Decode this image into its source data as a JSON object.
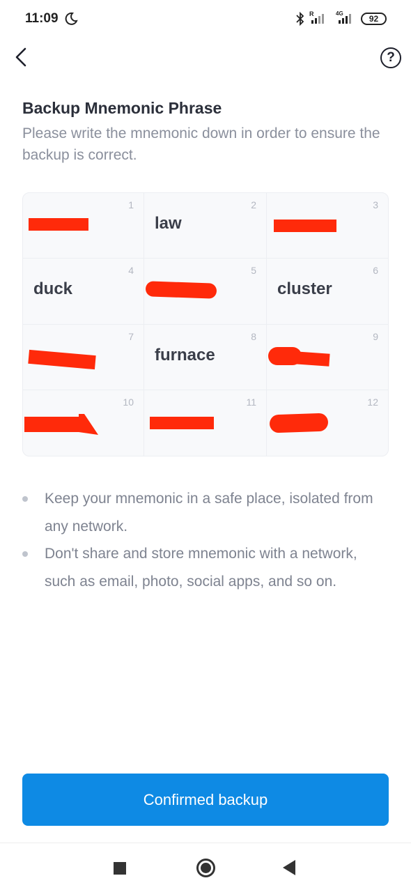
{
  "status_bar": {
    "time": "11:09",
    "battery": "92",
    "signal_1_label": "R",
    "signal_2_label": "4G"
  },
  "header": {
    "back_icon": "chevron-left-icon",
    "help_icon": "question-circle-icon",
    "help_label": "?"
  },
  "page": {
    "title": "Backup Mnemonic Phrase",
    "subtitle": "Please write the mnemonic down in order to ensure the backup is correct."
  },
  "mnemonic": {
    "words": [
      {
        "index": "1",
        "word": ""
      },
      {
        "index": "2",
        "word": "law"
      },
      {
        "index": "3",
        "word": ""
      },
      {
        "index": "4",
        "word": "duck"
      },
      {
        "index": "5",
        "word": ""
      },
      {
        "index": "6",
        "word": "cluster"
      },
      {
        "index": "7",
        "word": ""
      },
      {
        "index": "8",
        "word": "furnace"
      },
      {
        "index": "9",
        "word": ""
      },
      {
        "index": "10",
        "word": ""
      },
      {
        "index": "11",
        "word": ""
      },
      {
        "index": "12",
        "word": ""
      }
    ],
    "redaction_color": "#ff2a0a"
  },
  "tips": [
    "Keep your mnemonic in a safe place, isolated from any network.",
    "Don't share and store mnemonic with a network, such as email, photo, social apps, and so on."
  ],
  "confirm_button": {
    "label": "Confirmed backup",
    "color": "#0e8ae4"
  },
  "nav_bar": {
    "recents_icon": "square-icon",
    "home_icon": "circle-icon",
    "back_icon": "triangle-back-icon"
  }
}
